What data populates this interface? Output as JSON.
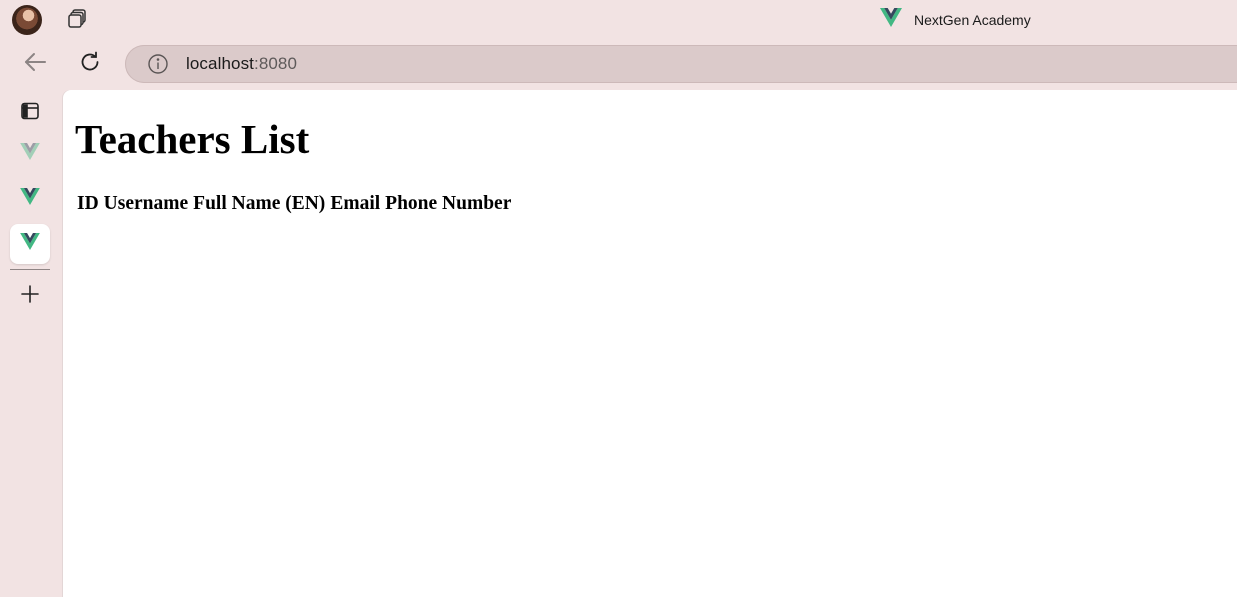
{
  "window": {
    "title": "NextGen Academy",
    "title_icon": "vue-logo-icon"
  },
  "toolbar": {
    "address": {
      "host": "localhost",
      "port": ":8080"
    }
  },
  "sidebar": {
    "tabs": [
      {
        "icon": "vue-logo-icon",
        "active": false,
        "dimmed": true
      },
      {
        "icon": "vue-logo-icon",
        "active": false,
        "dimmed": false
      },
      {
        "icon": "vue-logo-icon",
        "active": true,
        "dimmed": false
      }
    ]
  },
  "page": {
    "heading": "Teachers List",
    "table": {
      "columns": [
        "ID",
        "Username",
        "Full Name (EN)",
        "Email",
        "Phone Number"
      ],
      "rows": []
    }
  },
  "colors": {
    "chrome_bg": "#f2e3e3",
    "address_bg": "#dbcaca",
    "vue_green": "#42b883",
    "vue_dark": "#35495e"
  }
}
